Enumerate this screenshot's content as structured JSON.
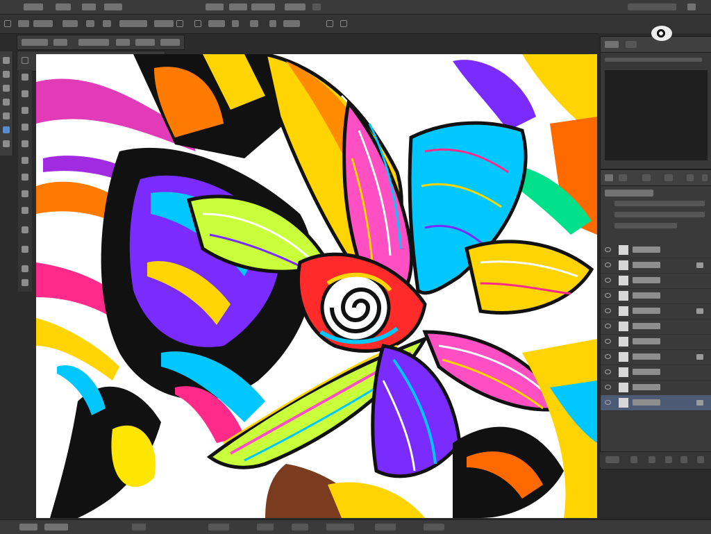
{
  "menubar": {
    "items": [
      "",
      "",
      "",
      "",
      "",
      "",
      "",
      ""
    ]
  },
  "options": {
    "label": ""
  },
  "document": {
    "tab_label": ""
  },
  "tools": [
    "move",
    "marquee",
    "lasso",
    "crop",
    "eyedropper",
    "brush",
    "stamp",
    "eraser",
    "gradient",
    "text",
    "pen",
    "shape"
  ],
  "navigator": {
    "tab": ""
  },
  "layers": {
    "rows": [
      {
        "name": "",
        "selected": false
      },
      {
        "name": "",
        "selected": false
      },
      {
        "name": "",
        "selected": false
      },
      {
        "name": "",
        "selected": false
      },
      {
        "name": "",
        "selected": false
      },
      {
        "name": "",
        "selected": false
      },
      {
        "name": "",
        "selected": false
      },
      {
        "name": "",
        "selected": false
      },
      {
        "name": "",
        "selected": false
      },
      {
        "name": "",
        "selected": false
      },
      {
        "name": "",
        "selected": true
      }
    ]
  },
  "status": {
    "zoom": "",
    "doc_info": ""
  },
  "colors": {
    "ui_dark": "#2b2b2b",
    "panel": "#3a3a3a",
    "selection": "#4c5a74",
    "art_palette": [
      "#ff0099",
      "#ffd400",
      "#00c8ff",
      "#ff6a00",
      "#7a2cff",
      "#00e08a",
      "#ff2a2a",
      "#111111"
    ]
  },
  "canvas": {
    "description": ""
  }
}
